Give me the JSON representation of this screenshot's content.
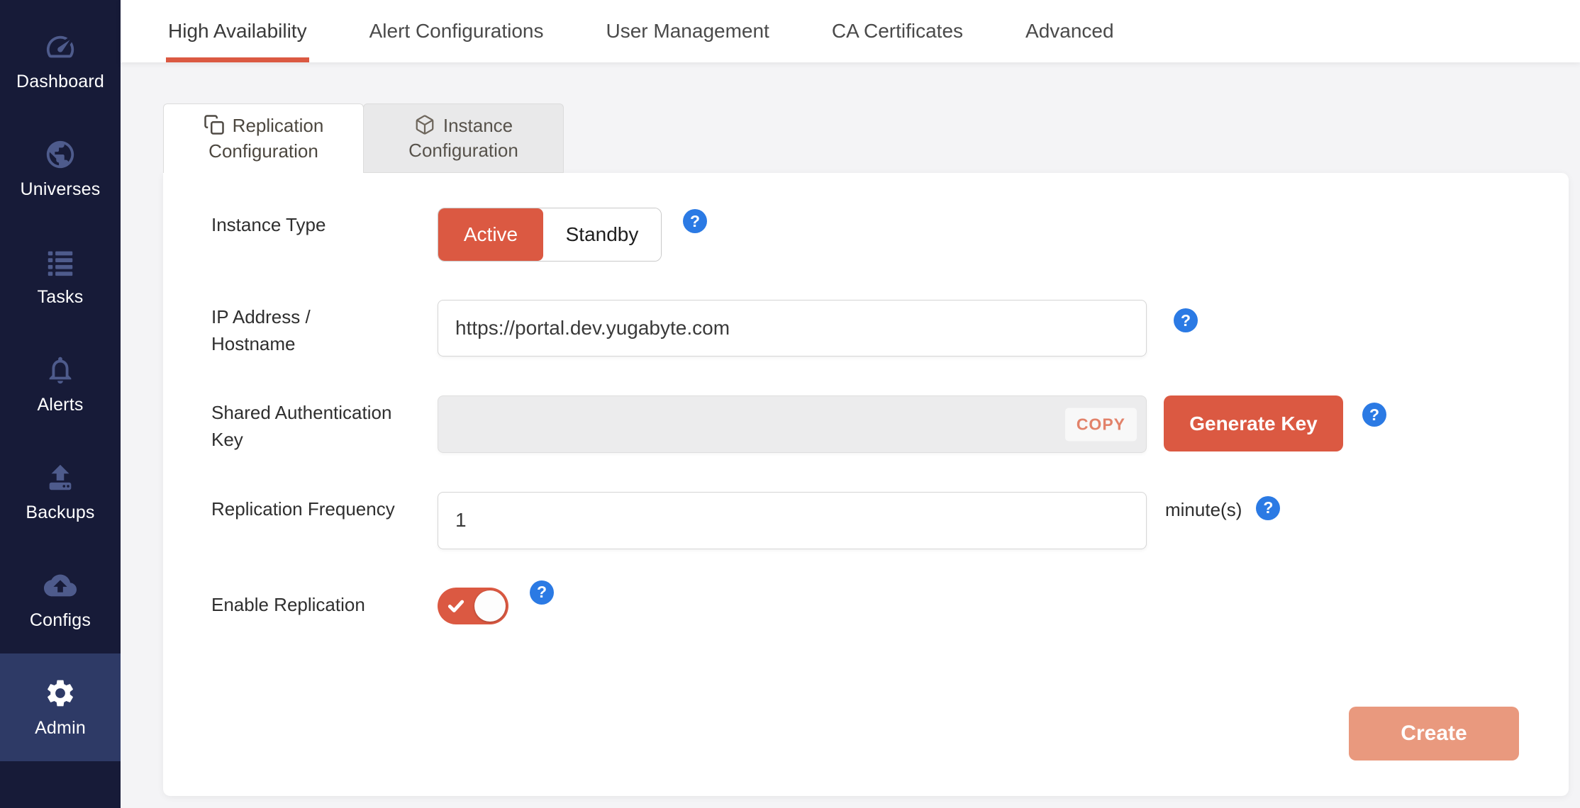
{
  "sidebar": {
    "items": [
      {
        "label": "Dashboard",
        "icon": "dashboard-gauge-icon",
        "active": false
      },
      {
        "label": "Universes",
        "icon": "universes-globe-icon",
        "active": false
      },
      {
        "label": "Tasks",
        "icon": "tasks-list-icon",
        "active": false
      },
      {
        "label": "Alerts",
        "icon": "alerts-bell-icon",
        "active": false
      },
      {
        "label": "Backups",
        "icon": "backups-upload-icon",
        "active": false
      },
      {
        "label": "Configs",
        "icon": "configs-cloud-upload-icon",
        "active": false
      },
      {
        "label": "Admin",
        "icon": "admin-gear-icon",
        "active": true
      }
    ]
  },
  "tabs": {
    "items": [
      {
        "label": "High Availability",
        "active": true
      },
      {
        "label": "Alert Configurations",
        "active": false
      },
      {
        "label": "User Management",
        "active": false
      },
      {
        "label": "CA Certificates",
        "active": false
      },
      {
        "label": "Advanced",
        "active": false
      }
    ]
  },
  "subtabs": {
    "items": [
      {
        "label": "Replication Configuration",
        "icon": "copy-icon",
        "active": true
      },
      {
        "label": "Instance Configuration",
        "icon": "cube-icon",
        "active": false
      }
    ]
  },
  "form": {
    "instance_type": {
      "label": "Instance Type",
      "options": [
        "Active",
        "Standby"
      ],
      "selected": "Active"
    },
    "ip_address": {
      "label": "IP Address / Hostname",
      "value": "https://portal.dev.yugabyte.com"
    },
    "shared_key": {
      "label": "Shared Authentication Key",
      "value": "",
      "copy_label": "COPY",
      "generate_label": "Generate Key"
    },
    "replication_frequency": {
      "label": "Replication Frequency",
      "value": "1",
      "unit": "minute(s)"
    },
    "enable_replication": {
      "label": "Enable Replication",
      "enabled": true
    },
    "create_label": "Create"
  },
  "icons": {
    "help_glyph": "?"
  },
  "colors": {
    "accent_orange": "#DB5942",
    "create_button_orange": "#E9997E",
    "help_blue": "#2B7AE4",
    "sidebar_bg": "#171B38",
    "sidebar_active_bg": "#2E3A66",
    "sidebar_icon": "#4E5B8C"
  }
}
